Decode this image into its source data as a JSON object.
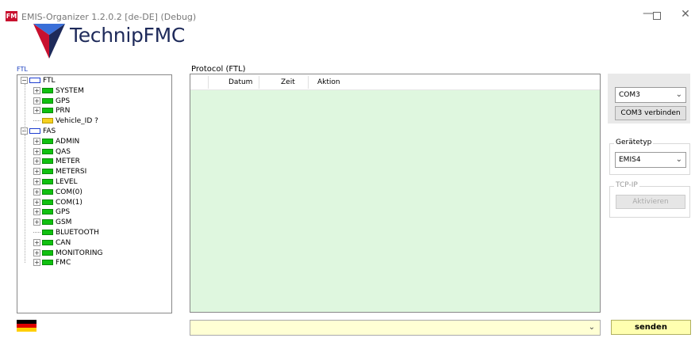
{
  "window": {
    "title": "EMIS-Organizer 1.2.0.2 [de-DE] (Debug)",
    "icon_text": "FM"
  },
  "logo": {
    "text": "TechnipFMC"
  },
  "tree": {
    "header_label": "FTL",
    "items": [
      {
        "label": "FTL",
        "icon": "blue",
        "expander": "minus"
      },
      {
        "label": "SYSTEM",
        "icon": "green",
        "expander": "plus"
      },
      {
        "label": "GPS",
        "icon": "green",
        "expander": "plus"
      },
      {
        "label": "PRN",
        "icon": "green",
        "expander": "plus"
      },
      {
        "label": "Vehicle_ID ?",
        "icon": "yellow",
        "expander": "none"
      },
      {
        "label": "FAS",
        "icon": "blue",
        "expander": "minus"
      },
      {
        "label": "ADMIN",
        "icon": "green",
        "expander": "plus"
      },
      {
        "label": "QAS",
        "icon": "green",
        "expander": "plus"
      },
      {
        "label": "METER",
        "icon": "green",
        "expander": "plus"
      },
      {
        "label": "METERSI",
        "icon": "green",
        "expander": "plus"
      },
      {
        "label": "LEVEL",
        "icon": "green",
        "expander": "plus"
      },
      {
        "label": "COM(0)",
        "icon": "green",
        "expander": "plus"
      },
      {
        "label": "COM(1)",
        "icon": "green",
        "expander": "plus"
      },
      {
        "label": "GPS",
        "icon": "green",
        "expander": "plus"
      },
      {
        "label": "GSM",
        "icon": "green",
        "expander": "plus"
      },
      {
        "label": "BLUETOOTH",
        "icon": "green",
        "expander": "none"
      },
      {
        "label": "CAN",
        "icon": "green",
        "expander": "plus"
      },
      {
        "label": "MONITORING",
        "icon": "green",
        "expander": "plus"
      },
      {
        "label": "FMC",
        "icon": "green",
        "expander": "plus"
      }
    ]
  },
  "protocol": {
    "title": "Protocol (FTL)",
    "columns": [
      "Datum",
      "Zeit",
      "Aktion"
    ]
  },
  "connection": {
    "port_value": "COM3",
    "connect_label": "COM3 verbinden"
  },
  "device_type": {
    "group_label": "Gerätetyp",
    "value": "EMIS4"
  },
  "tcpip": {
    "group_label": "TCP-IP",
    "activate_label": "Aktivieren"
  },
  "command": {
    "value": "",
    "send_label": "senden"
  },
  "colors": {
    "protocol_bg": "#dff7df",
    "command_bg": "#ffffd4",
    "send_bg": "#ffffb0",
    "node_green": "#10c010",
    "node_blue": "#1f3fd0",
    "node_yellow": "#f5d020",
    "logo_blue": "#1e2a5a",
    "logo_red": "#c8102e"
  },
  "language_flag": "de"
}
